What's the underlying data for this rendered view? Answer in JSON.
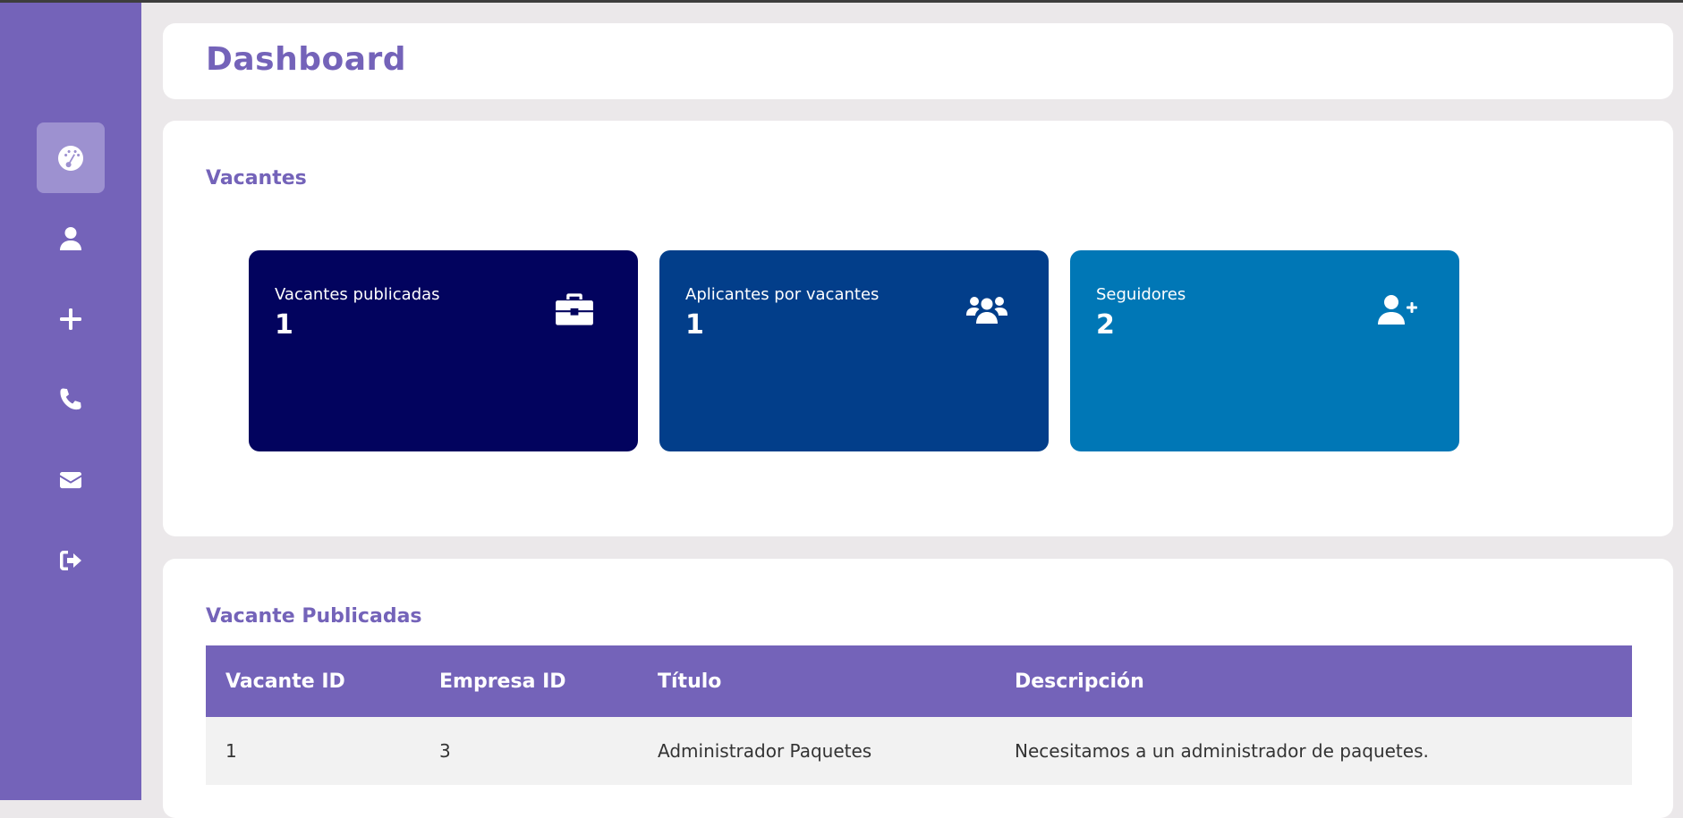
{
  "sidebar": {
    "items": [
      {
        "icon": "dashboard-gauge-icon",
        "active": true
      },
      {
        "icon": "user-icon",
        "active": false
      },
      {
        "icon": "plus-icon",
        "active": false
      },
      {
        "icon": "phone-icon",
        "active": false
      },
      {
        "icon": "envelope-icon",
        "active": false
      },
      {
        "icon": "sign-out-icon",
        "active": false
      }
    ],
    "colors": {
      "background": "#7463b9",
      "active": "#9d91d0"
    }
  },
  "header": {
    "title": "Dashboard"
  },
  "stats": {
    "section_title": "Vacantes",
    "cards": [
      {
        "label": "Vacantes publicadas",
        "value": "1",
        "icon": "briefcase-icon",
        "color": "#02035e"
      },
      {
        "label": "Aplicantes por vacantes",
        "value": "1",
        "icon": "users-icon",
        "color": "#023e8a"
      },
      {
        "label": "Seguidores",
        "value": "2",
        "icon": "user-plus-icon",
        "color": "#0077b6"
      }
    ]
  },
  "table": {
    "section_title": "Vacante Publicadas",
    "columns": [
      "Vacante ID",
      "Empresa ID",
      "Título",
      "Descripción"
    ],
    "rows": [
      [
        "1",
        "3",
        "Administrador Paquetes",
        "Necesitamos a un administrador de paquetes."
      ]
    ]
  }
}
